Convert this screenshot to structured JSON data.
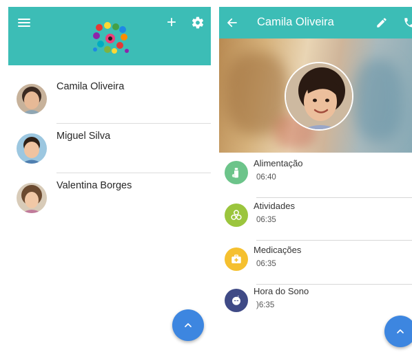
{
  "contacts_screen": {
    "icons": {
      "menu": "menu-icon",
      "add": "plus-icon",
      "settings": "gear-icon",
      "logo": "kids-logo",
      "fab": "chevron-up-icon"
    },
    "add_label": "+",
    "contacts": [
      {
        "name": "Camila Oliveira"
      },
      {
        "name": "Miguel Silva"
      },
      {
        "name": "Valentina Borges"
      }
    ]
  },
  "detail_screen": {
    "title": "Camila Oliveira",
    "icons": {
      "back": "arrow-back-icon",
      "edit": "pencil-icon",
      "call": "phone-icon",
      "fab": "chevron-up-icon"
    },
    "events": [
      {
        "title": "Alimentação",
        "time": "06:40",
        "icon": "food-icon",
        "color": "#6cc48a"
      },
      {
        "title": "Atividades",
        "time": "06:35",
        "icon": "blocks-icon",
        "color": "#9bc53d"
      },
      {
        "title": "Medicações",
        "time": "06:35",
        "icon": "medkit-icon",
        "color": "#f5c02f"
      },
      {
        "title": "Hora do Sono",
        "time": ")6:35",
        "icon": "sleep-icon",
        "color": "#3f4a86"
      }
    ]
  },
  "colors": {
    "appbar": "#3cbdb6",
    "fab": "#3d86e0"
  }
}
